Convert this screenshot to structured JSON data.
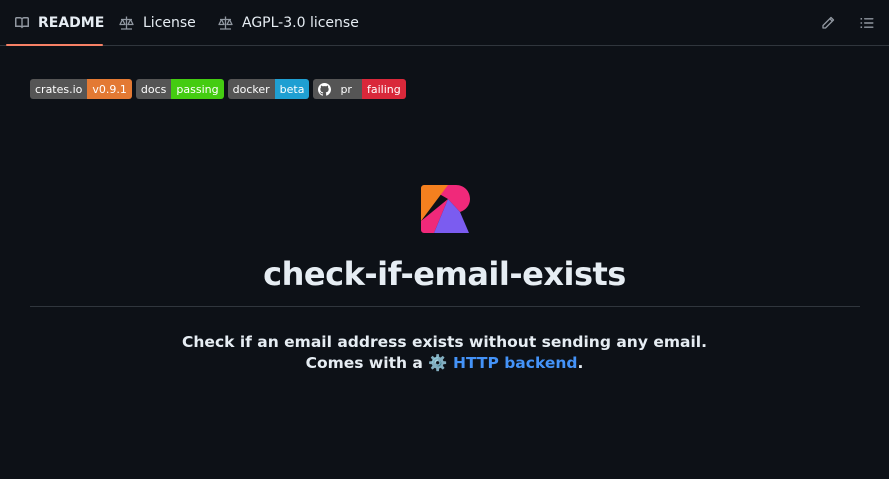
{
  "tabs": [
    {
      "label": "README",
      "icon": "book-icon",
      "active": true
    },
    {
      "label": "License",
      "icon": "scale-icon"
    },
    {
      "label": "AGPL-3.0 license",
      "icon": "scale-icon"
    }
  ],
  "toolbar": {
    "edit_icon": "pencil-icon",
    "outline_icon": "list-icon"
  },
  "badges": [
    {
      "label": "crates.io",
      "value": "v0.9.1",
      "color": "#e37933"
    },
    {
      "label": "docs",
      "value": "passing",
      "color": "#4c1"
    },
    {
      "label": "docker",
      "value": "beta",
      "color": "#1f9fd2"
    },
    {
      "label": "pr",
      "value": "failing",
      "color": "#d9283a",
      "icon": "github-icon"
    }
  ],
  "readme": {
    "title": "check-if-email-exists",
    "line1": "Check if an email address exists without sending any email.",
    "line2_prefix": "Comes with a ⚙️ ",
    "line2_link": "HTTP backend",
    "line2_suffix": "."
  },
  "colors": {
    "background": "#0d1117",
    "accent": "#f78166",
    "link": "#4493f8"
  }
}
